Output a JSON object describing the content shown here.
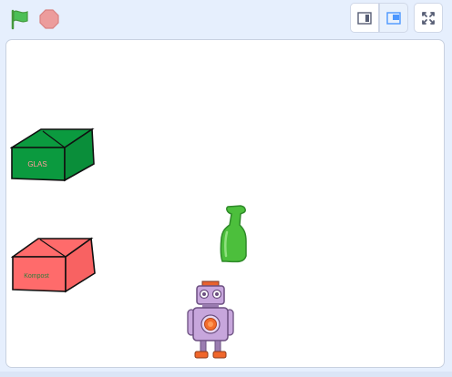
{
  "toolbar": {
    "green_flag": "green-flag-icon",
    "stop": "stop-sign-icon",
    "small_stage": "small-stage-layout-icon",
    "normal_stage": "normal-stage-layout-icon",
    "fullscreen": "fullscreen-icon"
  },
  "stage": {
    "sprites": [
      {
        "name": "glas-box",
        "label": "GLAS"
      },
      {
        "name": "kompost-box",
        "label": "Kompost"
      },
      {
        "name": "green-bottle"
      },
      {
        "name": "robot"
      }
    ]
  },
  "colors": {
    "background": "#e6effd",
    "flag": "#4cbf56",
    "stop": "#ec9c9c",
    "glas_box": "#0b9a3f",
    "kompost_box": "#ff6b6b",
    "bottle": "#4cbf3c",
    "robot_body": "#c7a6dc"
  }
}
